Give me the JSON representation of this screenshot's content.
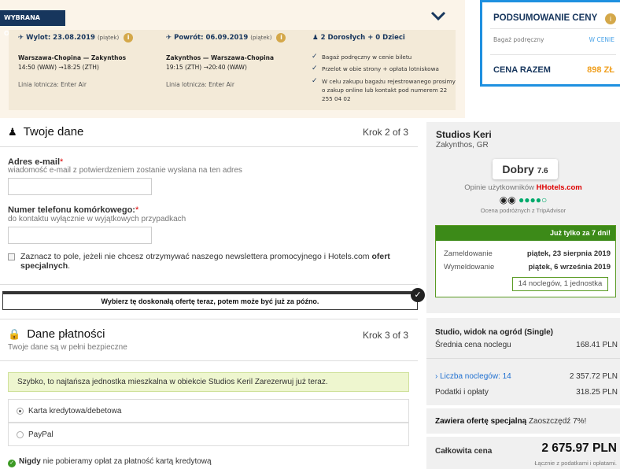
{
  "offer": {
    "tag": "WYBRANA OFERTA",
    "outbound": {
      "head": "Wylot: 23.08.2019",
      "day": "(piątek)",
      "route": "Warszawa-Chopina — Zakynthos",
      "times": "14:50 (WAW) →18:25 (ZTH)",
      "airline": "Linia lotnicza: Enter Air"
    },
    "inbound": {
      "head": "Powrót: 06.09.2019",
      "day": "(piątek)",
      "route": "Zakynthos — Warszawa-Chopina",
      "times": "19:15 (ZTH) →20:40 (WAW)",
      "airline": "Linia lotnicza: Enter Air"
    },
    "passengers": "2 Dorosłych + 0 Dzieci",
    "features": [
      "Bagaż podręczny w cenie biletu",
      "Przelot w obie strony + opłata lotniskowa",
      "W celu zakupu bagażu rejestrowanego prosimy o zakup online lub kontakt pod numerem 22 255 04 02"
    ]
  },
  "summary": {
    "title": "PODSUMOWANIE CENY",
    "baggage_label": "Bagaż podręczny",
    "baggage_value": "W CENIE",
    "total_label": "CENA RAZEM",
    "total_value": "898 ZŁ"
  },
  "personal": {
    "title": "Twoje dane",
    "step": "Krok 2 of 3",
    "email_label": "Adres e-mail",
    "email_hint": "wiadomość e-mail z potwierdzeniem zostanie wysłana na ten adres",
    "email_value": "",
    "phone_label": "Numer telefonu komórkowego:",
    "phone_hint": "do kontaktu wyłącznie w wyjątkowych przypadkach",
    "phone_value": "",
    "newsletter_text": "Zaznacz to pole, jeżeli nie chcesz otrzymywać naszego newslettera promocyjnego i Hotels.com",
    "newsletter_bold": "ofert specjalnych",
    "banner": "Wybierz tę doskonałą ofertę teraz, potem może być już za późno."
  },
  "payment": {
    "title": "Dane płatności",
    "subtitle": "Twoje dane są w pełni bezpieczne",
    "step": "Krok 3 of 3",
    "alert": "Szybko, to najtańsza jednostka mieszkalna w obiekcie Studios Keril Zarezerwuj już teraz.",
    "methods": [
      "Karta kredytowa/debetowa",
      "PayPal"
    ],
    "never_bold": "Nigdy",
    "never_text": "nie pobieramy opłat za płatność kartą kredytową"
  },
  "hotel": {
    "name": "Studios Keri",
    "location": "Zakynthos, GR",
    "rating_word": "Dobry",
    "rating_value": "7.6",
    "opinions": "Opinie użytkowników",
    "brand": "Hotels.com",
    "ta_caption": "Ocena podróżnych z TripAdvisor",
    "deal_banner": "Już tylko za 7 dni!",
    "checkin_label": "Zameldowanie",
    "checkin_value": "piątek, 23 sierpnia 2019",
    "checkout_label": "Wymeldowanie",
    "checkout_value": "piątek, 6 września 2019",
    "nights_units": "14 noclegów, 1 jednostka",
    "room_type": "Studio, widok na ogród (Single)",
    "avg_label": "Średnia cena noclegu",
    "avg_value": "168.41 PLN",
    "nights_label": "Liczba noclegów: 14",
    "nights_value": "2 357.72 PLN",
    "fees_label": "Podatki i opłaty",
    "fees_value": "318.25 PLN",
    "special_bold": "Zawiera ofertę specjalną",
    "special_text": "Zaoszczędź 7%!",
    "total_label": "Całkowita cena",
    "total_value": "2 675.97 PLN",
    "total_note": "Łącznie z podatkami i opłatami."
  }
}
